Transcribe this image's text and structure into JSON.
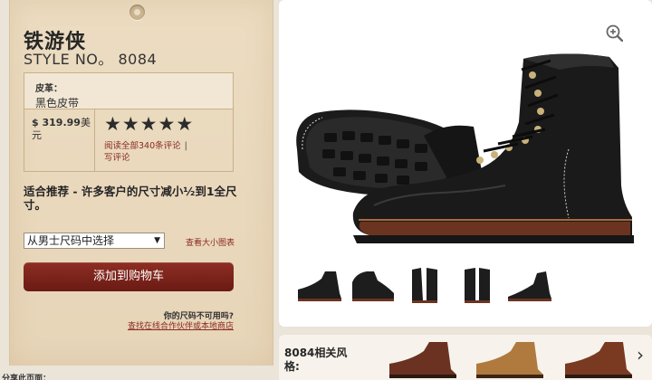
{
  "product": {
    "title": "铁游侠",
    "style_no": "STYLE NO。 8084",
    "leather_label": "皮革：",
    "leather_value": "黑色皮带",
    "price": "$ 319.99",
    "price_currency": "美元",
    "rating_stars": 5,
    "rating_icon": "star-icon",
    "read_reviews": "阅读全部340条评论",
    "write_review": "写评论",
    "review_separator": "|"
  },
  "fit_advice": "适合推荐 - 许多客户的尺寸减小½到1全尺寸。",
  "size_select": {
    "selected": "从男士尺码中选择"
  },
  "size_chart_link": "查看大小图表",
  "add_to_cart": "添加到购物车",
  "size_unavailable_question": "你的尺码不可用吗?",
  "find_partner_link": "查找在线合作伙伴或本地商店",
  "share_label": "分享此页面：",
  "related": {
    "label": "8084相关风格:",
    "next_icon": "chevron-right-icon"
  },
  "colors": {
    "accent_red": "#7a2219",
    "link_red": "#8b2a22",
    "tag_tan": "#e9d8bc"
  }
}
